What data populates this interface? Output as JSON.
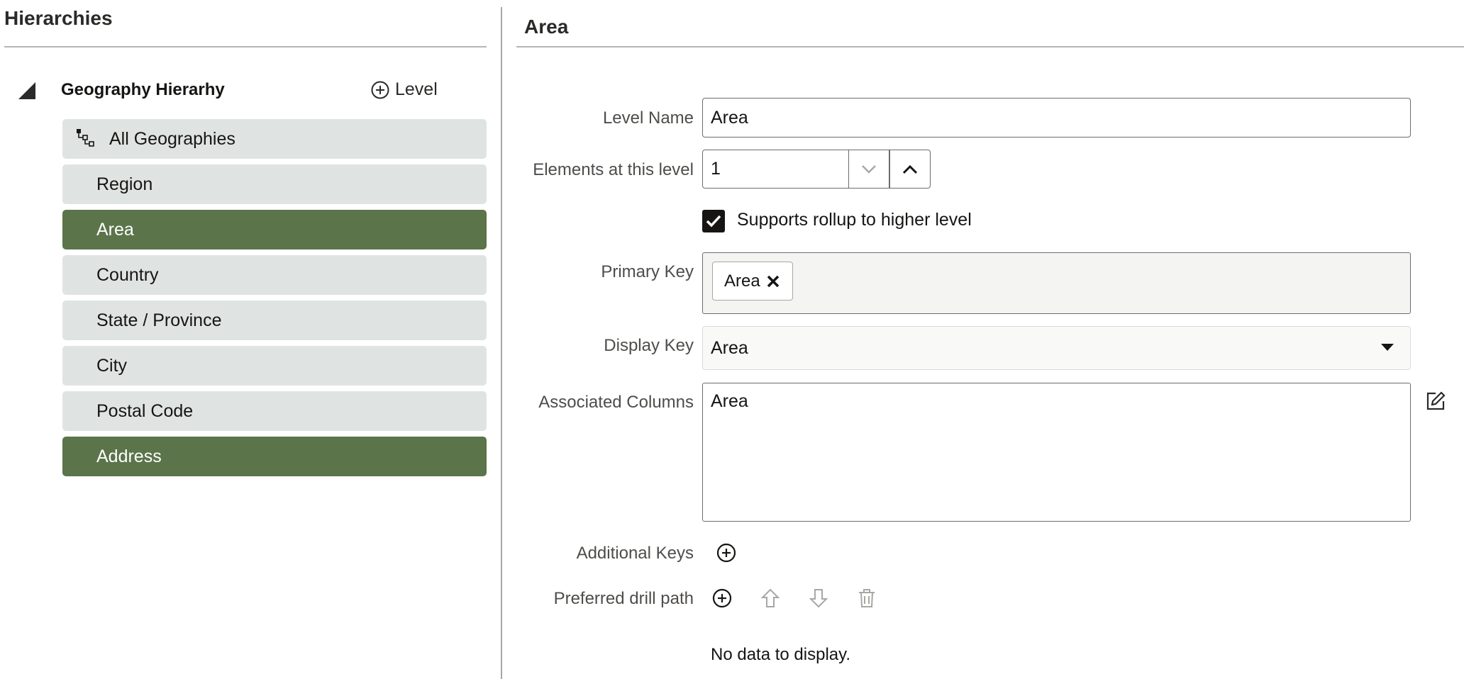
{
  "left_panel": {
    "title": "Hierarchies",
    "hierarchy": {
      "name": "Geography Hierarhy",
      "add_level_label": "Level",
      "levels": [
        {
          "label": "All Geographies",
          "selected": false,
          "root": true
        },
        {
          "label": "Region",
          "selected": false
        },
        {
          "label": "Area",
          "selected": true
        },
        {
          "label": "Country",
          "selected": false
        },
        {
          "label": "State / Province",
          "selected": false
        },
        {
          "label": "City",
          "selected": false
        },
        {
          "label": "Postal Code",
          "selected": false
        },
        {
          "label": "Address",
          "selected": true
        }
      ]
    }
  },
  "right_panel": {
    "title": "Area",
    "level_name": {
      "label": "Level Name",
      "value": "Area"
    },
    "elements": {
      "label": "Elements at this level",
      "value": "1"
    },
    "rollup": {
      "label": "Supports rollup to higher level",
      "checked": true
    },
    "primary_key": {
      "label": "Primary Key",
      "chips": [
        "Area"
      ]
    },
    "display_key": {
      "label": "Display Key",
      "value": "Area"
    },
    "associated_columns": {
      "label": "Associated Columns",
      "value": "Area"
    },
    "additional_keys": {
      "label": "Additional Keys"
    },
    "drill_path": {
      "label": "Preferred drill path",
      "empty_text": "No data to display."
    }
  },
  "colors": {
    "selected_bg": "#5b744a",
    "item_bg": "#dfe4e2",
    "border": "#6e6c69"
  }
}
